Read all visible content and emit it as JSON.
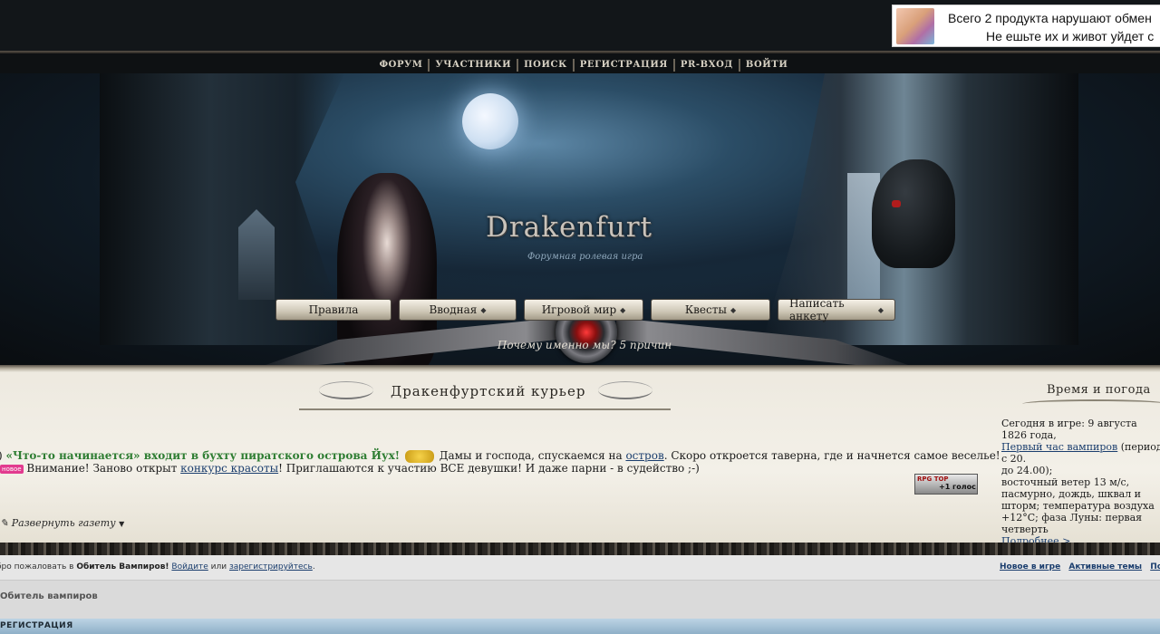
{
  "ad": {
    "line1": "Всего 2 продукта нарушают обмен",
    "line2": "Не ешьте их и живот уйдет с"
  },
  "nav": {
    "items": [
      "ФОРУМ",
      "УЧАСТНИКИ",
      "ПОИСК",
      "РЕГИСТРАЦИЯ",
      "PR-ВХОД",
      "ВОЙТИ"
    ]
  },
  "banner": {
    "logo": "Drakenfurt",
    "subtitle": "Форумная ролевая игра",
    "tabs": {
      "rules": "Правила",
      "intro": "Вводная",
      "world": "Игровой мир",
      "quests": "Квесты",
      "form": "Написать анкету"
    },
    "why": "Почему именно мы? 5 причин"
  },
  "courier": {
    "title": "Дракенфуртский курьер",
    "news1_highlight": "«Что-то начинается» входит в бухту пиратского острова Йух!",
    "news1_text_a": "Дамы и господа, спускаемся на",
    "news1_link": "остров",
    "news1_text_b": ". Скоро откроется таверна, где и начнется самое веселье!",
    "news2_badge": "новое",
    "news2_text_a": "Внимание! Заново открыт",
    "news2_link": "конкурс красоты",
    "news2_text_b": "! Приглашаются к участию ВСЕ девушки! И даже парни - в судейство ;-)",
    "expand": "Развернуть газету",
    "rpg_top_title": "RPG TOP",
    "rpg_top_vote": "+1 голос"
  },
  "weather": {
    "title": "Время и погода",
    "line_a": "Сегодня в игре: 9 августа 1826 года,",
    "link_a": "Первый час вампиров",
    "line_b": " (период с 20.",
    "line_c": "до 24.00);",
    "line_d": "восточный ветер 13 м/с, пасмурно, дождь, шквал и шторм; температура воздуха +12°C; фаза Луны: первая четверть",
    "more": "Подробнее >"
  },
  "welcome": {
    "prefix": "бро пожаловать в",
    "forum_name": "Обитель Вампиров!",
    "login": "Войдите",
    "or": "или",
    "register": "зарегистрируйтесь",
    "end": "."
  },
  "quick_links": [
    "Новое в игре",
    "Активные темы",
    "Под"
  ],
  "crumb": "Обитель вампиров",
  "section": "РЕГИСТРАЦИЯ"
}
